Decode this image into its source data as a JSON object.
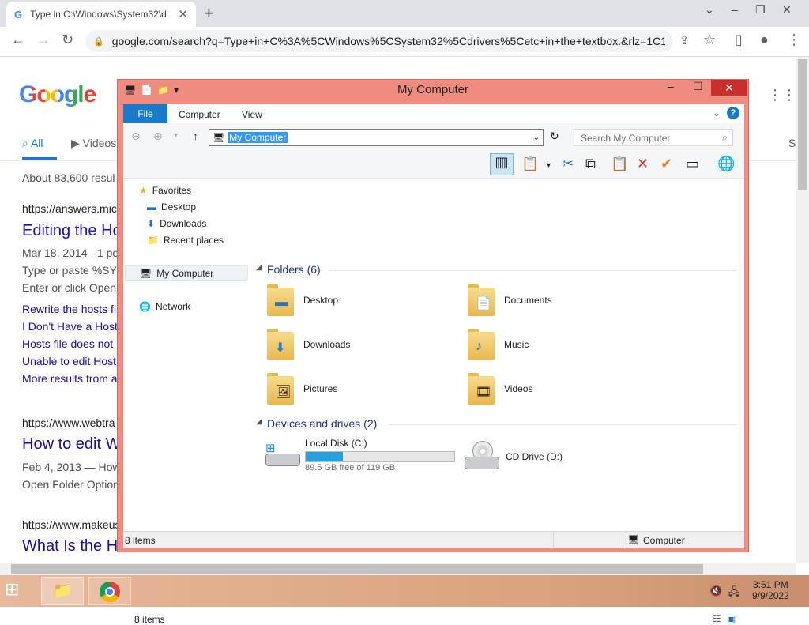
{
  "browser": {
    "tab_title": "Type in C:\\Windows\\System32\\d",
    "tab_favicon": "G",
    "url": "google.com/search?q=Type+in+C%3A%5CWindows%5CSystem32%5Cdrivers%5Cetc+in+the+textbox.&rlz=1C1...",
    "icons": {
      "back": "←",
      "forward": "→",
      "reload": "↻",
      "lock": "🔒",
      "share": "⇪",
      "star": "☆",
      "sidepanel": "▯",
      "profile": "●",
      "menu": "⋮",
      "new_tab": "+",
      "close": "✕",
      "minimize": "–",
      "restore": "❐",
      "tab_list": "⌄"
    }
  },
  "google": {
    "logo": "Google",
    "tabs": [
      "All",
      "Videos",
      "S"
    ],
    "results_count": "About 83,600 resul",
    "results": [
      {
        "url": "https://answers.mic",
        "title": "Editing the Ho",
        "date": "Mar 18, 2014 · 1 po",
        "snippet1": "Type or paste %SY",
        "snippet2": "Enter or click Open"
      },
      {
        "links": [
          "Rewrite the hosts fi",
          "I Don't Have a Host",
          "Hosts file does not",
          "Unable to edit Host",
          "More results from a"
        ]
      },
      {
        "url": "https://www.webtra",
        "title": "How to edit W",
        "date": "Feb 4, 2013 — How",
        "snippet1": "Open Folder Option"
      },
      {
        "url": "https://www.makeus",
        "title": "What Is the H"
      }
    ]
  },
  "explorer": {
    "title": "My Computer",
    "ribbon_tabs": {
      "file": "File",
      "computer": "Computer",
      "view": "View"
    },
    "address": "My Computer",
    "search_placeholder": "Search My Computer",
    "nav": {
      "favorites": "Favorites",
      "desktop": "Desktop",
      "downloads": "Downloads",
      "recent": "Recent places",
      "my_computer": "My Computer",
      "network": "Network"
    },
    "folders_header": "Folders (6)",
    "folders": [
      "Desktop",
      "Documents",
      "Downloads",
      "Music",
      "Pictures",
      "Videos"
    ],
    "drives_header": "Devices and drives (2)",
    "drive_c": {
      "name": "Local Disk (C:)",
      "free": "89.5 GB free of 119 GB",
      "used_fraction": 0.248
    },
    "drive_d": {
      "name": "CD Drive (D:)"
    },
    "status_items": "8 items",
    "statusbar_items": "8 items",
    "statusbar_location": "Computer"
  },
  "taskbar": {
    "time": "3:51 PM",
    "date": "9/9/2022"
  }
}
